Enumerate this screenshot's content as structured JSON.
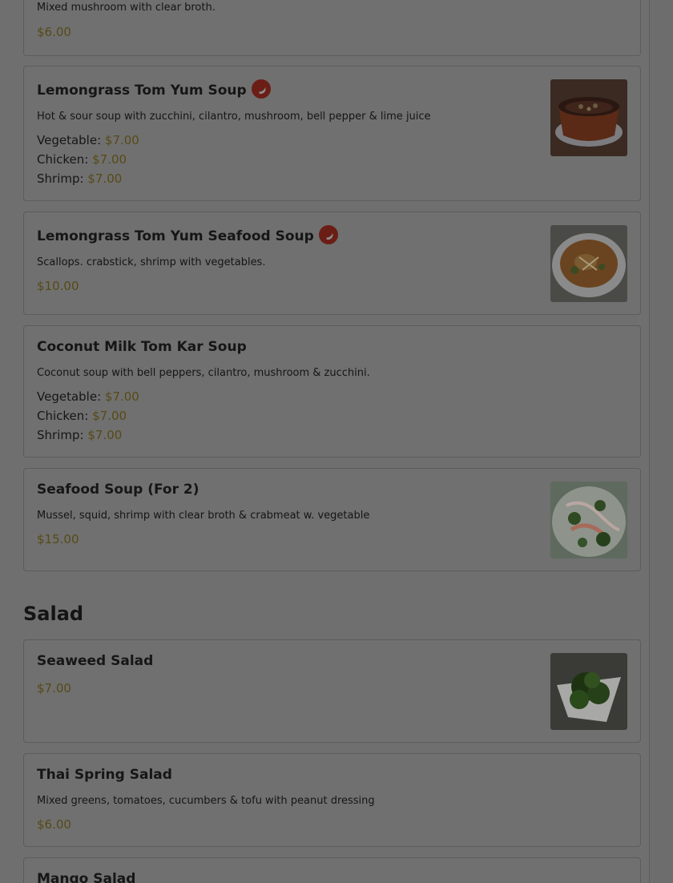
{
  "items": [
    {
      "title": "",
      "description": "Mixed mushroom with clear broth.",
      "price": "$6.00"
    },
    {
      "title": "Lemongrass Tom Yum Soup",
      "spicy_icon": "chili-pepper-icon",
      "description": "Hot & sour soup with zucchini, cilantro, mushroom, bell pepper & lime juice",
      "options": [
        {
          "label": "Vegetable:",
          "price": "$7.00"
        },
        {
          "label": "Chicken:",
          "price": "$7.00"
        },
        {
          "label": "Shrimp:",
          "price": "$7.00"
        }
      ]
    },
    {
      "title": "Lemongrass Tom Yum Seafood Soup",
      "spicy_icon": "chili-pepper-icon",
      "description": "Scallops. crabstick, shrimp with vegetables.",
      "price": "$10.00"
    },
    {
      "title": "Coconut Milk Tom Kar Soup",
      "description": "Coconut soup with bell peppers, cilantro, mushroom & zucchini.",
      "options": [
        {
          "label": "Vegetable:",
          "price": "$7.00"
        },
        {
          "label": "Chicken:",
          "price": "$7.00"
        },
        {
          "label": "Shrimp:",
          "price": "$7.00"
        }
      ]
    },
    {
      "title": "Seafood Soup (For 2)",
      "description": "Mussel, squid, shrimp with clear broth & crabmeat w. vegetable",
      "price": "$15.00"
    }
  ],
  "salad": {
    "heading": "Salad",
    "items": [
      {
        "title": "Seaweed Salad",
        "price": "$7.00"
      },
      {
        "title": "Thai Spring Salad",
        "description": "Mixed greens, tomatoes, cucumbers & tofu with peanut dressing",
        "price": "$6.00"
      },
      {
        "title": "Mango Salad"
      }
    ]
  },
  "colors": {
    "overlay_background": "#6f6f6f",
    "price_color": "#574a16",
    "spicy_badge": "#6a1e16"
  }
}
